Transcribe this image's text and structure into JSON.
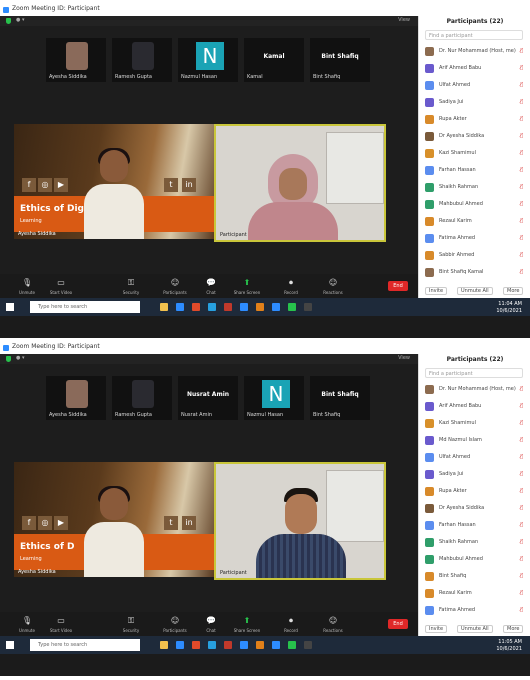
{
  "screens": [
    {
      "window_title": "Zoom Meeting ID: Participant",
      "meeting_label": "View",
      "thumbnails": [
        {
          "type": "video",
          "name": "Ayesha Siddika"
        },
        {
          "type": "video",
          "name": "Ramesh Gupta"
        },
        {
          "type": "letter",
          "letter": "N",
          "name": "Nazmul Hasan"
        },
        {
          "type": "name",
          "big": "Kamal",
          "name": "Kamal"
        },
        {
          "type": "name",
          "big": "Bint Shafiq",
          "name": "Bint Shafiq"
        }
      ],
      "main_left": {
        "overlay": "Ethics of Digital",
        "subtitle": "Learning",
        "label": "Ayesha Siddika"
      },
      "main_right": {
        "label": "Participant"
      },
      "toolbar": [
        "Unmute",
        "Start Video",
        "Security",
        "Participants",
        "Chat",
        "Share Screen",
        "Record",
        "Reactions"
      ],
      "end": "End",
      "participants_title": "Participants (22)",
      "search_placeholder": "Find a participant",
      "participants": [
        "Dr. Nur Mohammad (Host, me)",
        "Arif Ahmed Babu",
        "Ulfat Ahmed",
        "Sadiya Jui",
        "Rupa Akter",
        "Dr Ayesha Siddika",
        "Kazi Shamimul",
        "Farhan Hassan",
        "Shaikh Rahman",
        "Mahbubul Ahmed",
        "Rezaul Karim",
        "Fatima Ahmed",
        "Sabbir Ahmed",
        "Bint Shafiq Kamal"
      ],
      "avatar_colors": [
        "#8c6b4f",
        "#6a5acd",
        "#5b8def",
        "#6a5acd",
        "#d88a2a",
        "#7a5a3a",
        "#d8902a",
        "#5b8def",
        "#2f9e6a",
        "#2f9e6a",
        "#d88a2a",
        "#5b8def",
        "#d88a2a",
        "#8c6b4f"
      ],
      "participants_footer": [
        "Invite",
        "Unmute All",
        "More"
      ],
      "taskbar_search": "Type here to search",
      "clock": [
        "11:04 AM",
        "10/6/2021"
      ]
    },
    {
      "window_title": "Zoom Meeting ID: Participant",
      "meeting_label": "View",
      "thumbnails": [
        {
          "type": "video",
          "name": "Ayesha Siddika"
        },
        {
          "type": "video",
          "name": "Ramesh Gupta"
        },
        {
          "type": "name",
          "big": "Nusrat Amin",
          "name": "Nusrat Amin"
        },
        {
          "type": "letter",
          "letter": "N",
          "name": "Nazmul Hasan"
        },
        {
          "type": "name",
          "big": "Bint Shafiq",
          "name": "Bint Shafiq"
        }
      ],
      "main_left": {
        "overlay": "Ethics of D",
        "subtitle": "Learning",
        "label": "Ayesha Siddika"
      },
      "main_right": {
        "label": "Participant"
      },
      "toolbar": [
        "Unmute",
        "Start Video",
        "Security",
        "Participants",
        "Chat",
        "Share Screen",
        "Record",
        "Reactions"
      ],
      "end": "End",
      "participants_title": "Participants (22)",
      "search_placeholder": "Find a participant",
      "participants": [
        "Dr. Nur Mohammad (Host, me)",
        "Arif Ahmed Babu",
        "Kazi Shamimul",
        "Md Nazmul Islam",
        "Ulfat Ahmed",
        "Sadiya Jui",
        "Rupa Akter",
        "Dr Ayesha Siddika",
        "Farhan Hassan",
        "Shaikh Rahman",
        "Mahbubul Ahmed",
        "Bint Shafiq",
        "Rezaul Karim",
        "Fatima Ahmed"
      ],
      "avatar_colors": [
        "#8c6b4f",
        "#6a5acd",
        "#d8902a",
        "#6a5acd",
        "#5b8def",
        "#6a5acd",
        "#d88a2a",
        "#7a5a3a",
        "#5b8def",
        "#2f9e6a",
        "#2f9e6a",
        "#d88a2a",
        "#d88a2a",
        "#5b8def"
      ],
      "participants_footer": [
        "Invite",
        "Unmute All",
        "More"
      ],
      "taskbar_search": "Type here to search",
      "clock": [
        "11:05 AM",
        "10/6/2021"
      ]
    }
  ]
}
